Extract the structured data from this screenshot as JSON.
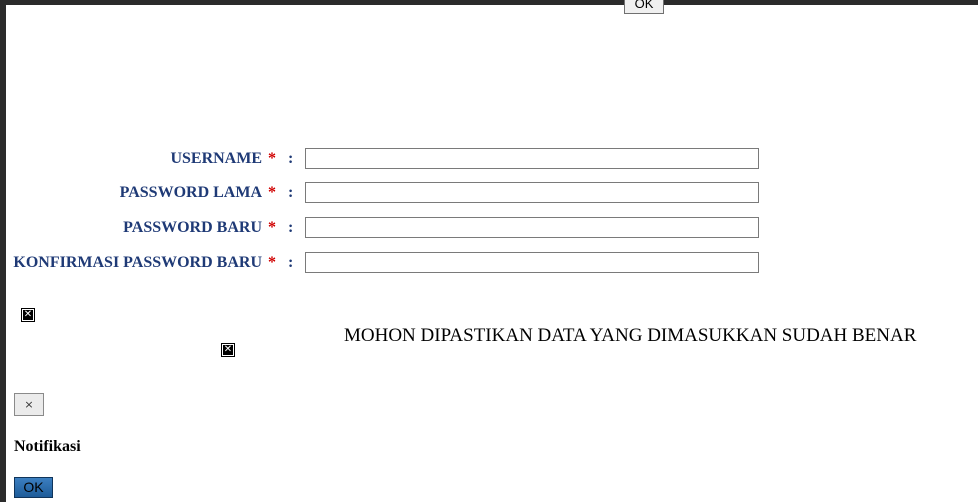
{
  "top_button": {
    "label": "OK"
  },
  "form": {
    "required_mark": "*",
    "separator": ":",
    "fields": [
      {
        "label": "USERNAME",
        "value": ""
      },
      {
        "label": "PASSWORD LAMA",
        "value": ""
      },
      {
        "label": "PASSWORD BARU",
        "value": ""
      },
      {
        "label": "KONFIRMASI PASSWORD BARU",
        "value": ""
      }
    ]
  },
  "notice": {
    "text": "MOHON DIPASTIKAN DATA YANG DIMASUKKAN SUDAH BENAR"
  },
  "dialog": {
    "close_label": "×",
    "title": "Notifikasi",
    "ok_label": "OK"
  },
  "icons": {
    "broken_image": "broken-image-icon",
    "close": "close-icon"
  },
  "colors": {
    "label": "#1f3a76",
    "required": "#d00000",
    "ok_button": "#2a6aa8"
  }
}
